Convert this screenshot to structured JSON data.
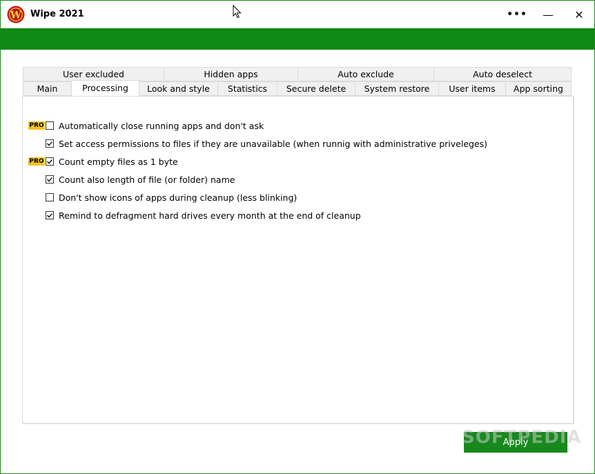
{
  "window": {
    "title": "Wipe 2021",
    "more_label": "•••",
    "minimize_label": "—",
    "close_label": "✕"
  },
  "tabs": {
    "row1": [
      "User excluded",
      "Hidden apps",
      "Auto exclude",
      "Auto deselect"
    ],
    "row2": [
      "Main",
      "Processing",
      "Look and style",
      "Statistics",
      "Secure delete",
      "System restore",
      "User items",
      "App sorting"
    ],
    "active": "Processing"
  },
  "options": [
    {
      "label": "Automatically close running apps and don't ask",
      "checked": false,
      "pro": true
    },
    {
      "label": "Set access permissions to files if they are unavailable (when runnig with administrative priveleges)",
      "checked": true,
      "pro": false
    },
    {
      "label": "Count empty files as 1 byte",
      "checked": true,
      "pro": true
    },
    {
      "label": "Count also length of file (or folder) name",
      "checked": true,
      "pro": false
    },
    {
      "label": "Don't show icons of apps during cleanup (less blinking)",
      "checked": false,
      "pro": false
    },
    {
      "label": "Remind to defragment hard drives every month at the end of cleanup",
      "checked": true,
      "pro": false
    }
  ],
  "pro_badge": "PRO",
  "apply_label": "Apply",
  "watermark": "SOFTPEDIA",
  "colors": {
    "accent_green": "#0f8a14",
    "apply_green": "#17891d",
    "pro_yellow": "#f5c41b"
  }
}
